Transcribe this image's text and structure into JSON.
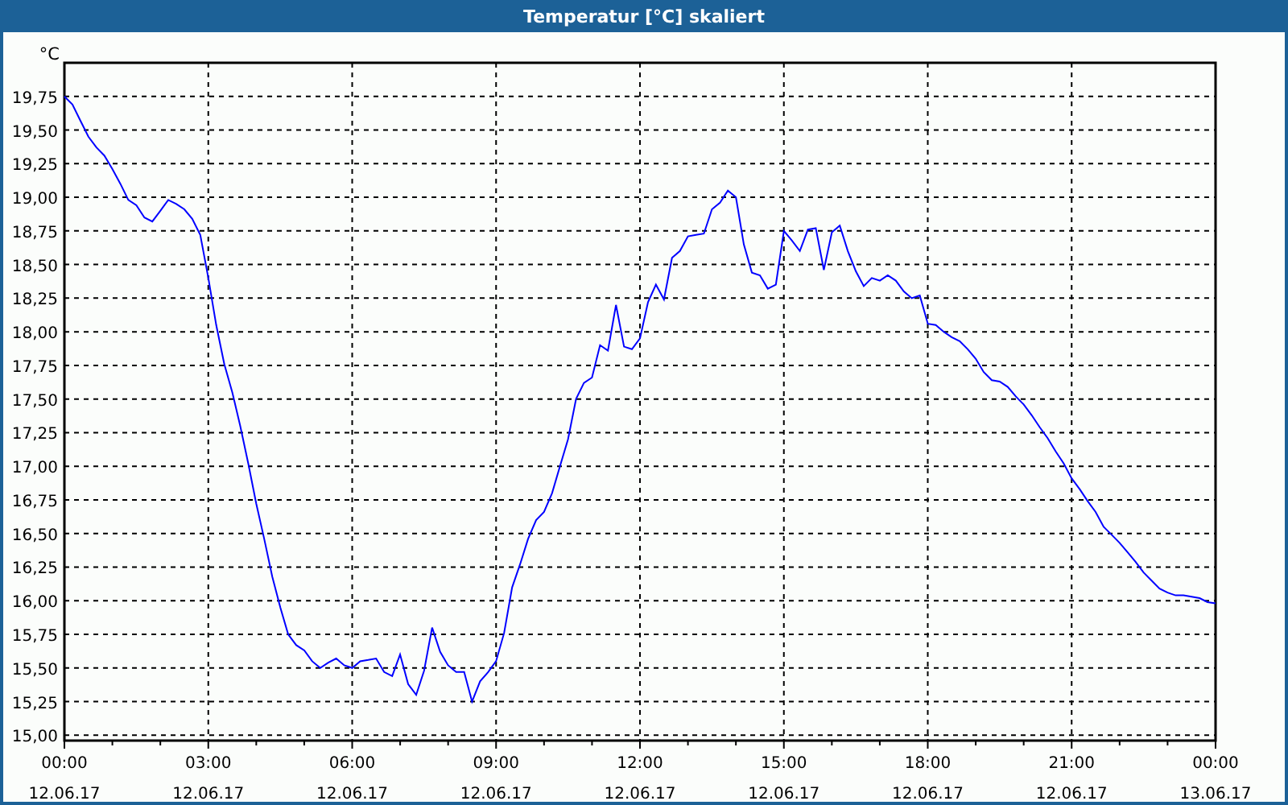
{
  "window": {
    "title": "Temperatur [°C] skaliert"
  },
  "chart": {
    "chart_data": {
      "type": "line",
      "grid": true,
      "ylabel": "°C",
      "ylim": [
        14.96,
        20
      ],
      "yticks": [
        {
          "value": 15,
          "label": "15,00"
        },
        {
          "value": 15.25,
          "label": "15,25"
        },
        {
          "value": 15.5,
          "label": "15,50"
        },
        {
          "value": 15.75,
          "label": "15,75"
        },
        {
          "value": 16,
          "label": "16,00"
        },
        {
          "value": 16.25,
          "label": "16,25"
        },
        {
          "value": 16.5,
          "label": "16,50"
        },
        {
          "value": 16.75,
          "label": "16,75"
        },
        {
          "value": 17,
          "label": "17,00"
        },
        {
          "value": 17.25,
          "label": "17,25"
        },
        {
          "value": 17.5,
          "label": "17,50"
        },
        {
          "value": 17.75,
          "label": "17,75"
        },
        {
          "value": 18,
          "label": "18,00"
        },
        {
          "value": 18.25,
          "label": "18,25"
        },
        {
          "value": 18.5,
          "label": "18,50"
        },
        {
          "value": 18.75,
          "label": "18,75"
        },
        {
          "value": 19,
          "label": "19,00"
        },
        {
          "value": 19.25,
          "label": "19,25"
        },
        {
          "value": 19.5,
          "label": "19,50"
        },
        {
          "value": 19.75,
          "label": "19,75"
        }
      ],
      "categories": [
        "00:00\n12.06.17",
        null,
        null,
        null,
        null,
        null,
        null,
        null,
        null,
        null,
        null,
        null,
        null,
        null,
        null,
        null,
        null,
        null,
        "03:00\n12.06.17",
        null,
        null,
        null,
        null,
        null,
        null,
        null,
        null,
        null,
        null,
        null,
        null,
        null,
        null,
        null,
        null,
        null,
        "06:00\n12.06.17",
        null,
        null,
        null,
        null,
        null,
        null,
        null,
        null,
        null,
        null,
        null,
        null,
        null,
        null,
        null,
        null,
        null,
        "09:00\n12.06.17",
        null,
        null,
        null,
        null,
        null,
        null,
        null,
        null,
        null,
        null,
        null,
        null,
        null,
        null,
        null,
        null,
        null,
        "12:00\n12.06.17",
        null,
        null,
        null,
        null,
        null,
        null,
        null,
        null,
        null,
        null,
        null,
        null,
        null,
        null,
        null,
        null,
        null,
        "15:00\n12.06.17",
        null,
        null,
        null,
        null,
        null,
        null,
        null,
        null,
        null,
        null,
        null,
        null,
        null,
        null,
        null,
        null,
        null,
        "18:00\n12.06.17",
        null,
        null,
        null,
        null,
        null,
        null,
        null,
        null,
        null,
        null,
        null,
        null,
        null,
        null,
        null,
        null,
        null,
        "21:00\n12.06.17",
        null,
        null,
        null,
        null,
        null,
        null,
        null,
        null,
        null,
        null,
        null,
        null,
        null,
        null,
        null,
        null,
        null,
        "00:00\n13.06.17"
      ],
      "series": [
        {
          "color": "#0000ff",
          "values": [
            19.75,
            19.69,
            19.57,
            19.45,
            19.37,
            19.31,
            19.21,
            19.1,
            18.98,
            18.94,
            18.85,
            18.82,
            18.9,
            18.98,
            18.95,
            18.91,
            18.84,
            18.72,
            18.4,
            18.05,
            17.76,
            17.55,
            17.3,
            17.02,
            16.72,
            16.46,
            16.18,
            15.95,
            15.75,
            15.67,
            15.63,
            15.55,
            15.5,
            15.54,
            15.57,
            15.52,
            15.5,
            15.55,
            15.56,
            15.57,
            15.47,
            15.44,
            15.6,
            15.38,
            15.3,
            15.48,
            15.8,
            15.62,
            15.52,
            15.47,
            15.47,
            15.25,
            15.4,
            15.47,
            15.55,
            15.76,
            16.1,
            16.27,
            16.46,
            16.6,
            16.66,
            16.8,
            17,
            17.2,
            17.5,
            17.62,
            17.66,
            17.9,
            17.86,
            18.2,
            17.89,
            17.87,
            17.95,
            18.22,
            18.35,
            18.24,
            18.55,
            18.6,
            18.71,
            18.72,
            18.73,
            18.91,
            18.96,
            19.05,
            19,
            18.65,
            18.44,
            18.42,
            18.32,
            18.35,
            18.75,
            18.68,
            18.6,
            18.76,
            18.77,
            18.46,
            18.74,
            18.79,
            18.6,
            18.45,
            18.34,
            18.4,
            18.38,
            18.42,
            18.38,
            18.3,
            18.25,
            18.27,
            18.06,
            18.05,
            18,
            17.96,
            17.93,
            17.87,
            17.8,
            17.7,
            17.64,
            17.63,
            17.59,
            17.52,
            17.46,
            17.38,
            17.29,
            17.21,
            17.11,
            17.02,
            16.91,
            16.83,
            16.74,
            16.66,
            16.55,
            16.49,
            16.43,
            16.36,
            16.29,
            16.21,
            16.15,
            16.09,
            16.06,
            16.04,
            16.04,
            16.03,
            16.02,
            15.99,
            15.98
          ]
        }
      ]
    }
  }
}
